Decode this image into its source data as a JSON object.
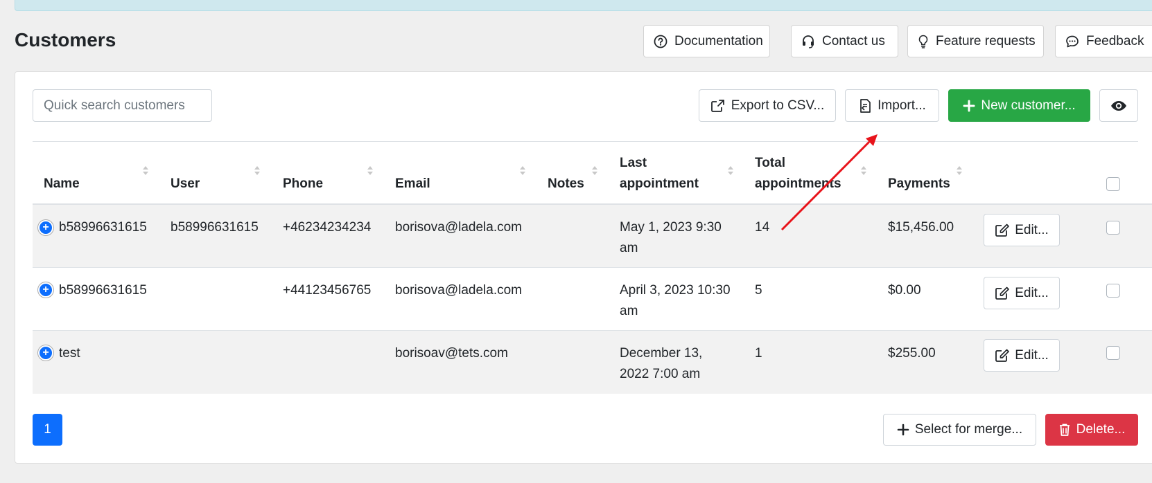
{
  "page": {
    "title": "Customers"
  },
  "header_buttons": {
    "documentation": "Documentation",
    "contact": "Contact us",
    "feature_requests": "Feature requests",
    "feedback": "Feedback"
  },
  "search": {
    "placeholder": "Quick search customers",
    "value": ""
  },
  "toolbar": {
    "export": "Export to CSV...",
    "import": "Import...",
    "new_customer": "New customer..."
  },
  "table": {
    "columns": {
      "name": "Name",
      "user": "User",
      "phone": "Phone",
      "email": "Email",
      "notes": "Notes",
      "last_appointment_1": "Last",
      "last_appointment_2": "appointment",
      "total_appointments_1": "Total",
      "total_appointments_2": "appointments",
      "payments": "Payments"
    },
    "rows": [
      {
        "name": "b58996631615",
        "user": "b58996631615",
        "phone": "+46234234234",
        "email": "borisova@ladela.com",
        "notes": "",
        "last_1": "May 1, 2023 9:30",
        "last_2": "am",
        "total": "14",
        "payments": "$15,456.00",
        "edit": "Edit..."
      },
      {
        "name": "b58996631615",
        "user": "",
        "phone": "+44123456765",
        "email": "borisova@ladela.com",
        "notes": "",
        "last_1": "April 3, 2023 10:30",
        "last_2": "am",
        "total": "5",
        "payments": "$0.00",
        "edit": "Edit..."
      },
      {
        "name": "test",
        "user": "",
        "phone": "",
        "email": "borisoav@tets.com",
        "notes": "",
        "last_1": "December 13,",
        "last_2": "2022 7:00 am",
        "total": "1",
        "payments": "$255.00",
        "edit": "Edit..."
      }
    ]
  },
  "pagination": {
    "current": "1"
  },
  "footer": {
    "merge": "Select for merge...",
    "delete": "Delete..."
  },
  "colors": {
    "primary": "#0d6efd",
    "success": "#28a745",
    "danger": "#dc3545",
    "annotation": "#e8141b"
  }
}
